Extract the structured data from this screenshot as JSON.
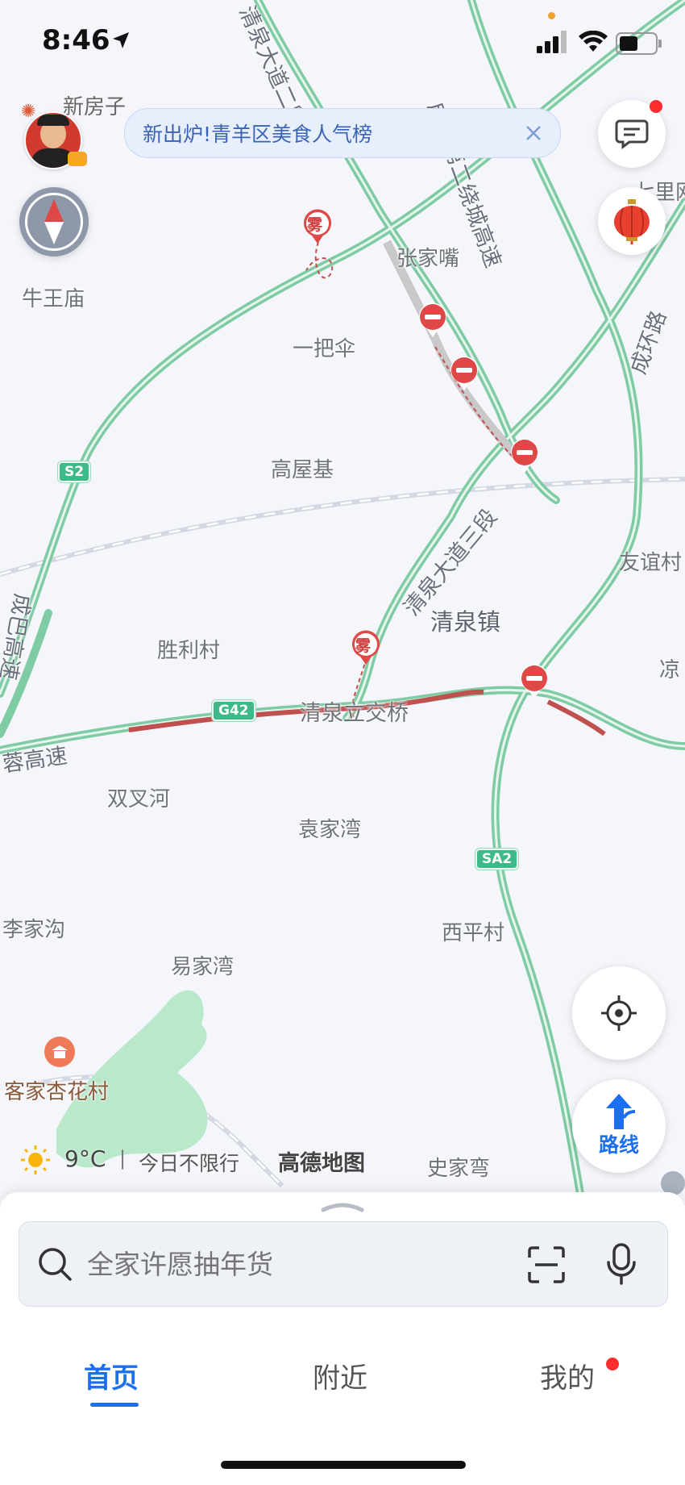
{
  "status_bar": {
    "time": "8:46"
  },
  "avatar": {
    "name": "新房子"
  },
  "banner": {
    "text": "新出炉!青羊区美食人气榜"
  },
  "map": {
    "places": [
      "牛王庙",
      "张家嘴",
      "一把伞",
      "高屋基",
      "友谊村",
      "清泉镇",
      "胜利村",
      "清泉立交桥",
      "双叉河",
      "袁家湾",
      "李家沟",
      "西平村",
      "易家湾",
      "客家杏花村",
      "史家弯",
      "七里网",
      "凉"
    ],
    "roads": [
      "成都第二绕城高速",
      "清泉大道二段",
      "清泉大道三段",
      "成环路",
      "成巴高速",
      "蓉高速"
    ],
    "shields": [
      "S2",
      "G42",
      "SA2"
    ],
    "markers": {
      "fog": "雾"
    }
  },
  "weather": {
    "temp": "9°C",
    "separator": "|",
    "restriction": "今日不限行"
  },
  "brand": "高德地图",
  "route_button": {
    "label": "路线"
  },
  "search": {
    "placeholder": "全家许愿抽年货"
  },
  "tabs": [
    {
      "label": "首页"
    },
    {
      "label": "附近"
    },
    {
      "label": "我的"
    }
  ],
  "colors": {
    "accent": "#1c6ff0",
    "road": "#8fd3b0",
    "jam": "#c0504d",
    "red_dot": "#ff2d2d"
  }
}
